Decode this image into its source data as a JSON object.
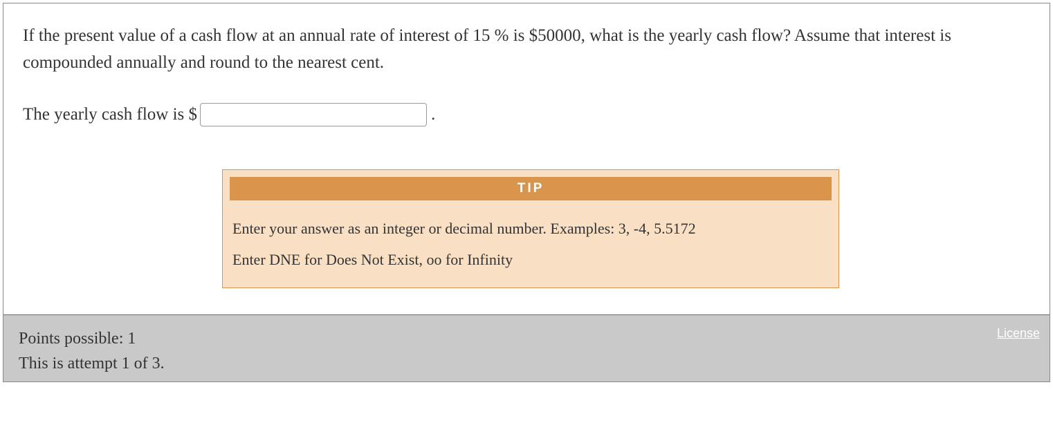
{
  "question": {
    "prompt": "If the present value of a cash flow at an annual rate of interest of 15 %  is $50000, what is the yearly cash flow? Assume that interest is compounded annually and round to the nearest cent.",
    "answer_prefix": "The yearly cash flow is $",
    "answer_value": "",
    "answer_suffix": "."
  },
  "tip": {
    "header": "TIP",
    "lines": [
      "Enter your answer as an integer or decimal number. Examples: 3, -4, 5.5172",
      "Enter DNE for Does Not Exist, oo for Infinity"
    ]
  },
  "footer": {
    "points": "Points possible: 1",
    "attempt": "This is attempt 1 of 3.",
    "license": "License"
  }
}
